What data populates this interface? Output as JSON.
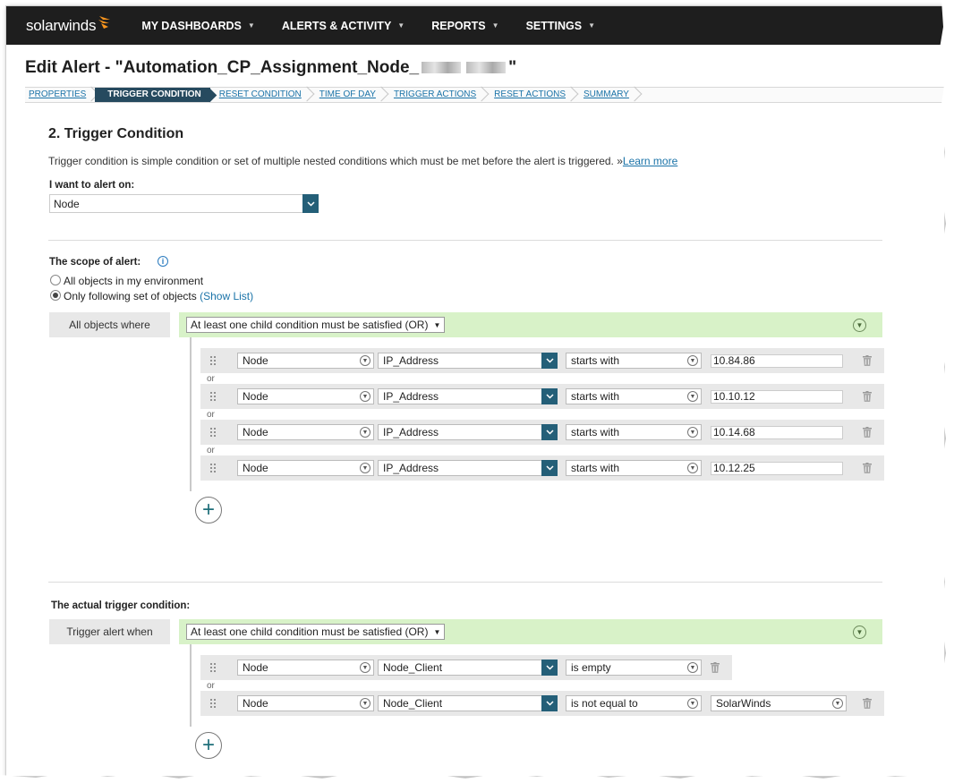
{
  "app": {
    "logo": "solarwinds"
  },
  "nav": [
    {
      "label": "MY DASHBOARDS"
    },
    {
      "label": "ALERTS & ACTIVITY"
    },
    {
      "label": "REPORTS"
    },
    {
      "label": "SETTINGS"
    }
  ],
  "page": {
    "title_prefix": "Edit Alert - \"Automation_CP_Assignment_Node_",
    "title_suffix": "\""
  },
  "wizard": [
    {
      "label": "PROPERTIES",
      "active": false
    },
    {
      "label": "TRIGGER CONDITION",
      "active": true
    },
    {
      "label": "RESET CONDITION",
      "active": false
    },
    {
      "label": "TIME OF DAY",
      "active": false
    },
    {
      "label": "TRIGGER ACTIONS",
      "active": false
    },
    {
      "label": "RESET ACTIONS",
      "active": false
    },
    {
      "label": "SUMMARY",
      "active": false
    }
  ],
  "section": {
    "title": "2. Trigger Condition",
    "description": "Trigger condition is simple condition or set of multiple nested conditions which must be met before the alert is triggered. »",
    "learn_more": "Learn more"
  },
  "alert_on": {
    "label": "I want to alert on:",
    "value": "Node"
  },
  "scope": {
    "label": "The scope of alert:",
    "radio_all": "All objects in my environment",
    "radio_following": "Only following set of objects",
    "show_list": "(Show List)",
    "selected": "following",
    "tag": "All objects where",
    "group_mode": "At least one child condition must be satisfied (OR)",
    "or_label": "or",
    "conditions": [
      {
        "object": "Node",
        "field": "IP_Address",
        "operator": "starts with",
        "value": "10.84.86"
      },
      {
        "object": "Node",
        "field": "IP_Address",
        "operator": "starts with",
        "value": "10.10.12"
      },
      {
        "object": "Node",
        "field": "IP_Address",
        "operator": "starts with",
        "value": "10.14.68"
      },
      {
        "object": "Node",
        "field": "IP_Address",
        "operator": "starts with",
        "value": "10.12.25"
      }
    ]
  },
  "trigger": {
    "label": "The actual trigger condition:",
    "tag": "Trigger alert when",
    "group_mode": "At least one child condition must be satisfied (OR)",
    "or_label": "or",
    "conditions": [
      {
        "object": "Node",
        "field": "Node_Client",
        "operator": "is empty",
        "value": ""
      },
      {
        "object": "Node",
        "field": "Node_Client",
        "operator": "is not equal to",
        "value": "SolarWinds"
      }
    ]
  },
  "colors": {
    "nav_bg": "#1e1e1e",
    "accent": "#245f78",
    "link": "#1a73a8",
    "group_bg": "#d8f2c8",
    "flame": "#f7941d"
  }
}
